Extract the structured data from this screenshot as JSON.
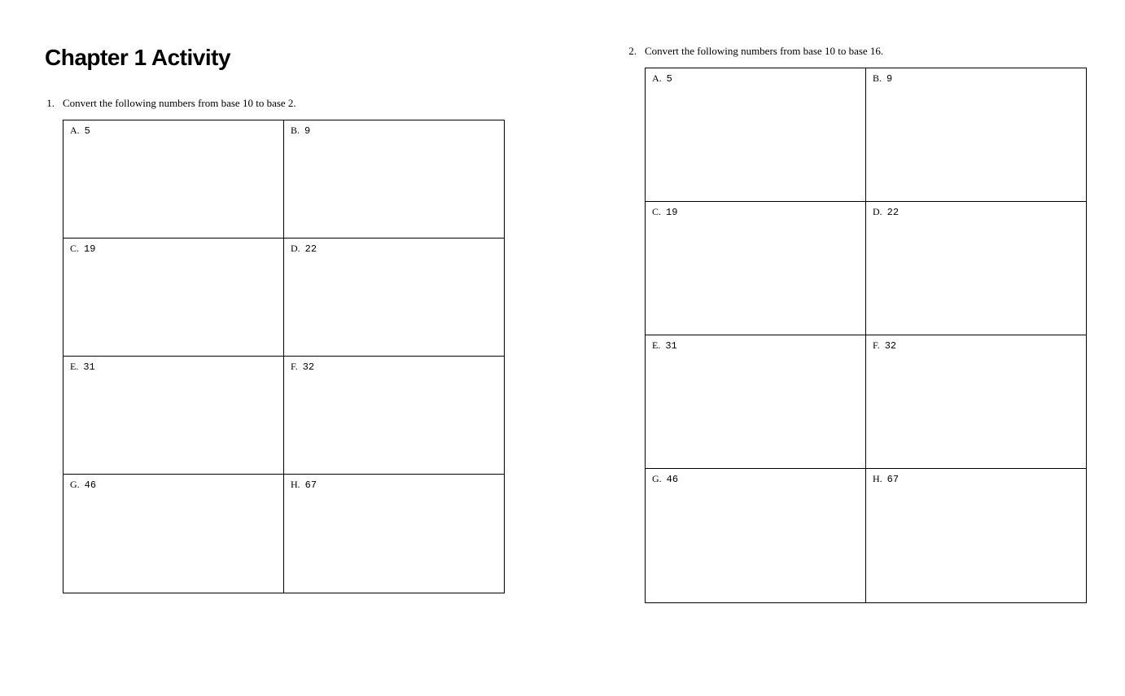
{
  "title": "Chapter 1 Activity",
  "questions": [
    {
      "number": "1.",
      "text": "Convert the following numbers from base 10 to base 2.",
      "rows": [
        [
          {
            "letter": "A.",
            "value": "5"
          },
          {
            "letter": "B.",
            "value": "9"
          }
        ],
        [
          {
            "letter": "C.",
            "value": "19"
          },
          {
            "letter": "D.",
            "value": "22"
          }
        ],
        [
          {
            "letter": "E.",
            "value": "31"
          },
          {
            "letter": "F.",
            "value": "32"
          }
        ],
        [
          {
            "letter": "G.",
            "value": "46"
          },
          {
            "letter": "H.",
            "value": "67"
          }
        ]
      ]
    },
    {
      "number": "2.",
      "text": "Convert the following numbers from base 10 to base 16.",
      "rows": [
        [
          {
            "letter": "A.",
            "value": "5"
          },
          {
            "letter": "B.",
            "value": "9"
          }
        ],
        [
          {
            "letter": "C.",
            "value": "19"
          },
          {
            "letter": "D.",
            "value": "22"
          }
        ],
        [
          {
            "letter": "E.",
            "value": "31"
          },
          {
            "letter": "F.",
            "value": "32"
          }
        ],
        [
          {
            "letter": "G.",
            "value": "46"
          },
          {
            "letter": "H.",
            "value": "67"
          }
        ]
      ]
    }
  ]
}
